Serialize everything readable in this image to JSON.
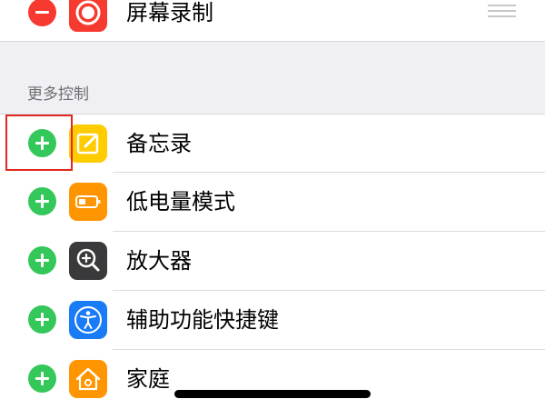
{
  "included_controls": [
    {
      "label": "屏幕录制",
      "action": "remove",
      "icon": "screen-record-icon",
      "icon_bg": "#f73a2f"
    }
  ],
  "section": {
    "title": "更多控制"
  },
  "more_controls": [
    {
      "label": "备忘录",
      "action": "add",
      "icon": "notes-icon",
      "icon_bg": "#ffcc00"
    },
    {
      "label": "低电量模式",
      "action": "add",
      "icon": "low-power-battery-icon",
      "icon_bg": "#ff9500"
    },
    {
      "label": "放大器",
      "action": "add",
      "icon": "magnifier-icon",
      "icon_bg": "#3a3a3c"
    },
    {
      "label": "辅助功能快捷键",
      "action": "add",
      "icon": "accessibility-icon",
      "icon_bg": "#1a7cf5"
    },
    {
      "label": "家庭",
      "action": "add",
      "icon": "home-icon",
      "icon_bg": "#ff9500"
    }
  ],
  "colors": {
    "add_green": "#34c759",
    "remove_red": "#f73a2f",
    "highlight_red": "#e0281e"
  }
}
